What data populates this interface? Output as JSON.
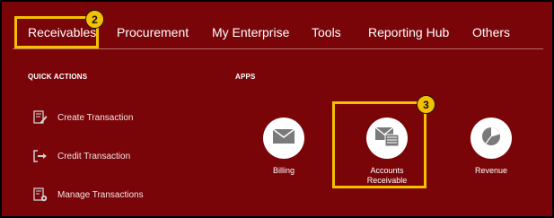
{
  "nav": {
    "tabs": [
      {
        "label": "Receivables"
      },
      {
        "label": "Procurement"
      },
      {
        "label": "My Enterprise"
      },
      {
        "label": "Tools"
      },
      {
        "label": "Reporting Hub"
      },
      {
        "label": "Others"
      }
    ]
  },
  "steps": {
    "nav_step": "2",
    "app_step": "3"
  },
  "quick_actions": {
    "title": "QUICK ACTIONS",
    "items": [
      {
        "label": "Create Transaction",
        "icon": "edit-document-icon"
      },
      {
        "label": "Credit Transaction",
        "icon": "export-arrow-icon"
      },
      {
        "label": "Manage Transactions",
        "icon": "settings-document-icon"
      }
    ]
  },
  "apps": {
    "title": "APPS",
    "items": [
      {
        "label": "Billing",
        "icon": "envelope-icon"
      },
      {
        "label_line1": "Accounts",
        "label_line2": "Receivable",
        "icon": "envelope-document-icon"
      },
      {
        "label": "Revenue",
        "icon": "pie-chart-icon"
      }
    ]
  },
  "colors": {
    "background": "#7a0509",
    "highlight": "#f5c000",
    "text": "#ffffff"
  }
}
